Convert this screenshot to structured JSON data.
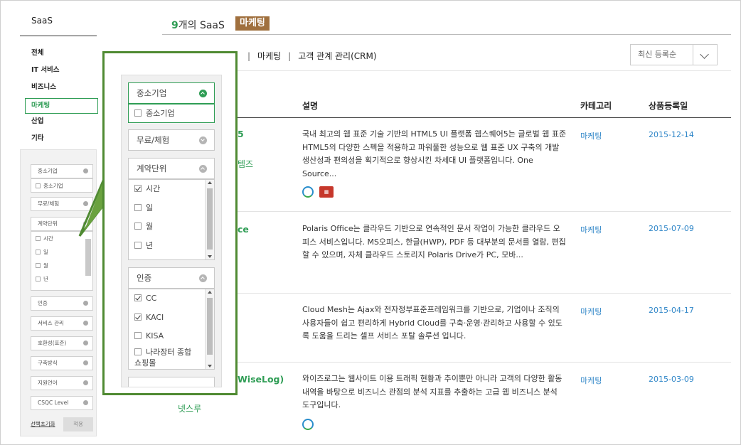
{
  "sidebar": {
    "title": "SaaS",
    "nav": [
      "전체",
      "IT 서비스",
      "비즈니스",
      "마케팅",
      "산업",
      "기타"
    ],
    "filters": {
      "sme": "중소기업",
      "sme_option": "중소기업",
      "free": "무료/체험",
      "contract": "계약단위",
      "contract_options": [
        "시간",
        "일",
        "월",
        "년"
      ],
      "cert": "인증",
      "service": "서비스 관리",
      "compat": "호환성(표준)",
      "build": "구축방식",
      "lang": "지원언어",
      "csqc": "CSQC Level",
      "reset": "선택초기화",
      "apply": "적용"
    }
  },
  "header": {
    "count": "9",
    "title_rest": "개의 SaaS",
    "tag": "마케팅",
    "crumbs": [
      "마케팅",
      "고객 관계 관리(CRM)"
    ],
    "sort": "최신 등록순"
  },
  "table": {
    "headers": {
      "desc": "설명",
      "category": "카테고리",
      "date": "상품등록일"
    },
    "rows": [
      {
        "name": "5",
        "name_sub": "템즈",
        "desc": "국내 최고의 웹 표준 기술 기반의 HTML5 UI 플랫폼 웹스퀘어5는 글로벌 웹 표준 HTML5의 다양한 스펙을 적용하고 파워풀한 성능으로 웹 표준 UX 구축의 개발 생산성과 편의성을 획기적으로 향상시킨 차세대 UI 플랫폼입니다. One Source...",
        "category": "마케팅",
        "date": "2015-12-14"
      },
      {
        "name": "ce",
        "desc": "Polaris Office는 클라우드 기반으로 연속적인 문서 작업이 가능한 클라우드 오피스 서비스입니다. MS오피스, 한글(HWP), PDF 등 대부분의 문서를 열람, 편집할 수 있으며, 자체 클라우드 스토리지 Polaris Drive가 PC, 모바...",
        "category": "마케팅",
        "date": "2015-07-09"
      },
      {
        "desc": "Cloud Mesh는 Ajax와 전자정부표준프레임워크를 기반으로, 기업이나 조직의 사용자들이 쉽고 편리하게 Hybrid Cloud를 구축·운영·관리하고 사용할 수 있도록 도움을 드리는 셀프 서비스 포탈 솔루션 입니다.",
        "category": "마케팅",
        "date": "2015-04-17"
      },
      {
        "name": "WiseLog)",
        "name_sub": "넷스루",
        "desc": "와이즈로그는 웹사이트 이용 트래픽 현황과 추이뿐만 아니라 고객의 다양한 활동내역을 바탕으로 비즈니스 관점의 분석 지표를 추출하는 고급 웹 비즈니스 분석 도구입니다.",
        "category": "마케팅",
        "date": "2015-03-09"
      }
    ]
  },
  "popup": {
    "sme": "중소기업",
    "sme_option": "중소기업",
    "free": "무료/체험",
    "contract": "계약단위",
    "contract_options": [
      "시간",
      "일",
      "월",
      "년"
    ],
    "cert": "인증",
    "cert_options": [
      "CC",
      "KACI",
      "KISA",
      "나라장터 종합"
    ],
    "cert_option_wrap": "쇼핑몰"
  },
  "colors": {
    "brand_green": "#2f9d55",
    "callout_green": "#4f8a32",
    "tag_brown": "#a0703e",
    "link_blue": "#2f86c8"
  }
}
